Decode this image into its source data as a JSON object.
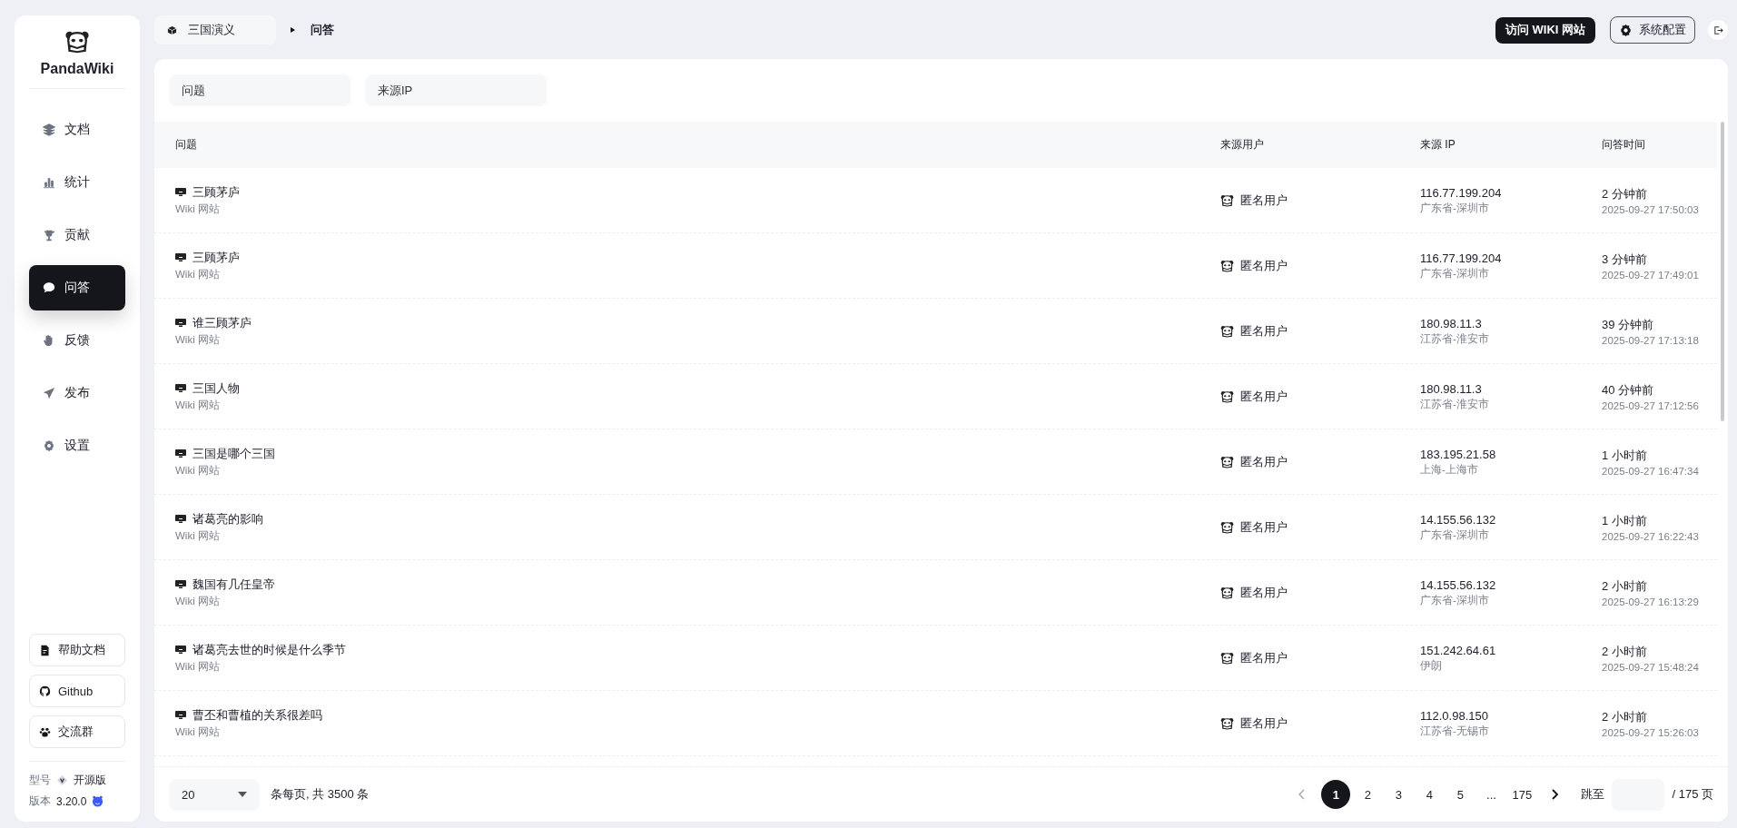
{
  "sidebar": {
    "brand": "PandaWiki",
    "nav": [
      {
        "label": "文档",
        "selected": false
      },
      {
        "label": "统计",
        "selected": false
      },
      {
        "label": "贡献",
        "selected": false
      },
      {
        "label": "问答",
        "selected": true
      },
      {
        "label": "反馈",
        "selected": false
      },
      {
        "label": "发布",
        "selected": false
      },
      {
        "label": "设置",
        "selected": false
      }
    ],
    "links": [
      "帮助文档",
      "Github",
      "交流群"
    ],
    "edition_label": "型号",
    "edition": "开源版",
    "version_label": "版本",
    "version": "3.20.0"
  },
  "topbar": {
    "wiki": "三国演义",
    "page": "问答",
    "visit_button": "访问 WIKI 网站",
    "config_button": "系统配置"
  },
  "filters": [
    {
      "placeholder": "问题"
    },
    {
      "placeholder": "来源IP"
    }
  ],
  "table": {
    "columns": [
      "问题",
      "来源用户",
      "来源 IP",
      "问答时间"
    ],
    "rows": [
      {
        "question": "三顾茅庐",
        "source": "Wiki 网站",
        "user": "匿名用户",
        "ip": "116.77.199.204",
        "location": "广东省-深圳市",
        "ago": "2 分钟前",
        "time": "2025-09-27 17:50:03"
      },
      {
        "question": "三顾茅庐",
        "source": "Wiki 网站",
        "user": "匿名用户",
        "ip": "116.77.199.204",
        "location": "广东省-深圳市",
        "ago": "3 分钟前",
        "time": "2025-09-27 17:49:01"
      },
      {
        "question": "谁三顾茅庐",
        "source": "Wiki 网站",
        "user": "匿名用户",
        "ip": "180.98.11.3",
        "location": "江苏省-淮安市",
        "ago": "39 分钟前",
        "time": "2025-09-27 17:13:18"
      },
      {
        "question": "三国人物",
        "source": "Wiki 网站",
        "user": "匿名用户",
        "ip": "180.98.11.3",
        "location": "江苏省-淮安市",
        "ago": "40 分钟前",
        "time": "2025-09-27 17:12:56"
      },
      {
        "question": "三国是哪个三国",
        "source": "Wiki 网站",
        "user": "匿名用户",
        "ip": "183.195.21.58",
        "location": "上海-上海市",
        "ago": "1 小时前",
        "time": "2025-09-27 16:47:34"
      },
      {
        "question": "诸葛亮的影响",
        "source": "Wiki 网站",
        "user": "匿名用户",
        "ip": "14.155.56.132",
        "location": "广东省-深圳市",
        "ago": "1 小时前",
        "time": "2025-09-27 16:22:43"
      },
      {
        "question": "魏国有几任皇帝",
        "source": "Wiki 网站",
        "user": "匿名用户",
        "ip": "14.155.56.132",
        "location": "广东省-深圳市",
        "ago": "2 小时前",
        "time": "2025-09-27 16:13:29"
      },
      {
        "question": "诸葛亮去世的时候是什么季节",
        "source": "Wiki 网站",
        "user": "匿名用户",
        "ip": "151.242.64.61",
        "location": "伊朗",
        "ago": "2 小时前",
        "time": "2025-09-27 15:48:24"
      },
      {
        "question": "曹丕和曹植的关系很差吗",
        "source": "Wiki 网站",
        "user": "匿名用户",
        "ip": "112.0.98.150",
        "location": "江苏省-无锡市",
        "ago": "2 小时前",
        "time": "2025-09-27 15:26:03"
      }
    ]
  },
  "pagination": {
    "page_size": "20",
    "summary": "条每页, 共 3500 条",
    "pages": [
      {
        "label": "1",
        "selected": true
      },
      {
        "label": "2",
        "selected": false
      },
      {
        "label": "3",
        "selected": false
      },
      {
        "label": "4",
        "selected": false
      },
      {
        "label": "5",
        "selected": false
      },
      {
        "label": "...",
        "selected": false
      },
      {
        "label": "175",
        "selected": false
      }
    ],
    "jump_label": "跳至",
    "total": "/ 175 页"
  }
}
